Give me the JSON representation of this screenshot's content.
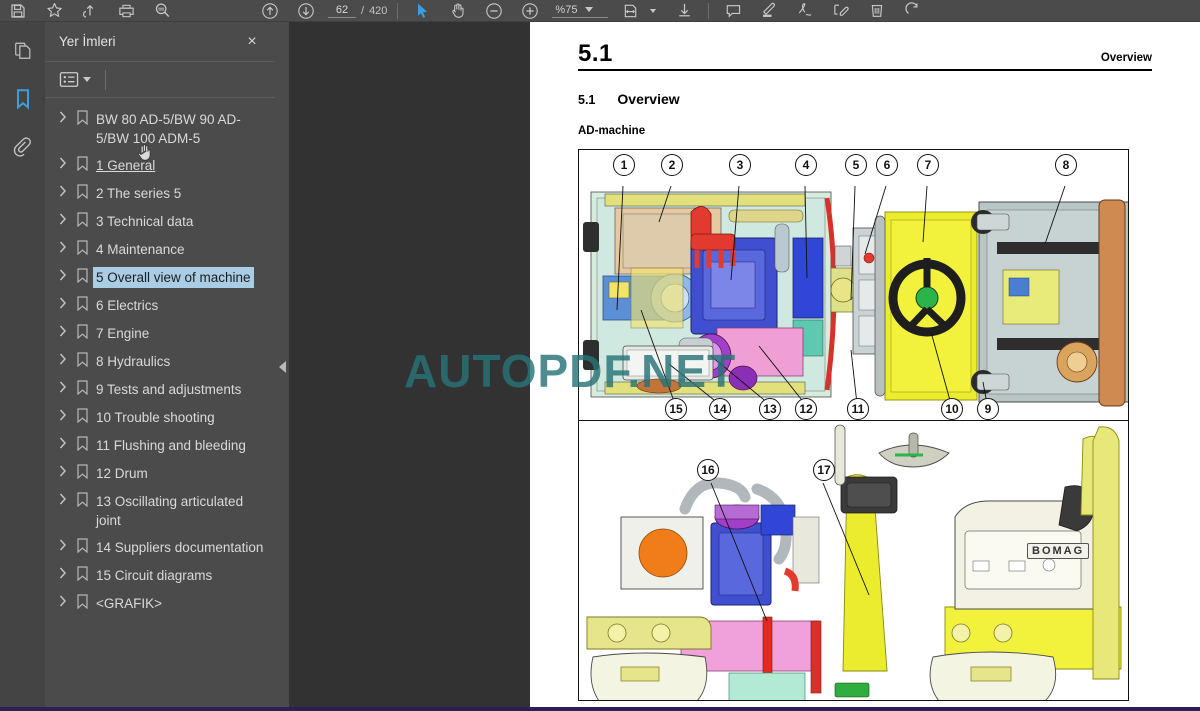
{
  "toolbar": {
    "left_tools": [
      {
        "name": "save-icon",
        "label": "Kaydet"
      },
      {
        "name": "star-icon",
        "label": "Yer imi ekle"
      },
      {
        "name": "share-icon",
        "label": "Paylas"
      },
      {
        "name": "print-icon",
        "label": "Yazdir"
      },
      {
        "name": "search-icon",
        "label": "Ara"
      }
    ],
    "page_up_label": "Onceki sayfa",
    "page_down_label": "Sonraki sayfa",
    "page_current": "62",
    "page_separator": "/",
    "page_total": "420",
    "select_tool_label": "Sec",
    "hand_tool_label": "El araci",
    "zoom_out_label": "Uzaklastir",
    "zoom_in_label": "Yakinlastir",
    "zoom_value": "%75",
    "fit_label": "Sayfaya sigdir",
    "download_label": "Indir",
    "comment_label": "Yorum",
    "highlight_label": "Vurgula",
    "draw_label": "Ciz",
    "sign_label": "Imzala",
    "delete_label": "Sil",
    "rotate_label": "Dondur"
  },
  "rail": {
    "items": [
      {
        "name": "pages-icon",
        "label": "Sayfalar",
        "active": false
      },
      {
        "name": "bookmark-icon",
        "label": "Yer Imleri",
        "active": true
      },
      {
        "name": "attachment-icon",
        "label": "Ekler",
        "active": false
      }
    ]
  },
  "panel": {
    "title": "Yer İmleri",
    "close_label": "×",
    "options_label": "Secenekler",
    "bookmarks": [
      {
        "label": "BW 80 AD-5/BW 90 AD-5/BW 100 ADM-5",
        "selected": false,
        "underlined": false
      },
      {
        "label": "1 General",
        "selected": false,
        "underlined": true
      },
      {
        "label": "2 The series 5",
        "selected": false,
        "underlined": false
      },
      {
        "label": "3 Technical data",
        "selected": false,
        "underlined": false
      },
      {
        "label": "4 Maintenance",
        "selected": false,
        "underlined": false
      },
      {
        "label": "5 Overall view of machine",
        "selected": true,
        "underlined": false
      },
      {
        "label": "6 Electrics",
        "selected": false,
        "underlined": false
      },
      {
        "label": "7 Engine",
        "selected": false,
        "underlined": false
      },
      {
        "label": "8 Hydraulics",
        "selected": false,
        "underlined": false
      },
      {
        "label": "9 Tests and adjustments",
        "selected": false,
        "underlined": false
      },
      {
        "label": "10 Trouble shooting",
        "selected": false,
        "underlined": false
      },
      {
        "label": "11 Flushing and bleeding",
        "selected": false,
        "underlined": false
      },
      {
        "label": "12 Drum",
        "selected": false,
        "underlined": false
      },
      {
        "label": "13 Oscillating articulated joint",
        "selected": false,
        "underlined": false
      },
      {
        "label": "14 Suppliers documentation",
        "selected": false,
        "underlined": false
      },
      {
        "label": "15 Circuit diagrams",
        "selected": false,
        "underlined": false
      },
      {
        "label": "<GRAFIK>",
        "selected": false,
        "underlined": false
      }
    ]
  },
  "collapse_handle_label": "Paneli daralt",
  "document": {
    "header_number": "5.1",
    "header_right": "Overview",
    "section_number": "5.1",
    "section_title": "Overview",
    "subsection_title": "AD-machine",
    "watermark": "AUTOPDF.NET",
    "brand_badge": "BOMAG",
    "figure_top": {
      "callouts_top": [
        "1",
        "2",
        "3",
        "4",
        "5",
        "6",
        "7",
        "8"
      ],
      "callouts_bottom": [
        "15",
        "14",
        "13",
        "12",
        "11",
        "10",
        "9"
      ]
    },
    "figure_bottom": {
      "callouts": [
        "16",
        "17"
      ]
    }
  },
  "colors": {
    "toolbar_bg": "#4b4b4b",
    "panel_bg": "#4b4b4b",
    "viewer_bg": "#323232",
    "accent_blue": "#3c9ee0",
    "selection_blue": "#a9cde4",
    "watermark_teal": "#287376"
  }
}
